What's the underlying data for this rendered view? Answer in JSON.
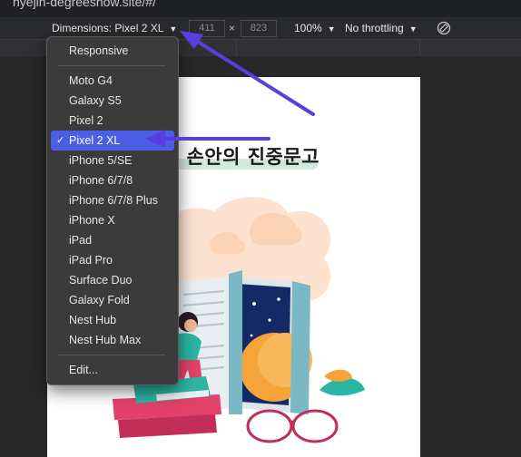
{
  "browser": {
    "url_fragment": "hyejin-degreeshow.site/#/"
  },
  "toolbar": {
    "dimensions_label": "Dimensions: Pixel 2 XL",
    "width_value": "411",
    "height_value": "823",
    "times": "×",
    "zoom": "100%",
    "throttling": "No throttling",
    "rotate_icon": "rotate-icon"
  },
  "menu": {
    "responsive": "Responsive",
    "devices": [
      "Moto G4",
      "Galaxy S5",
      "Pixel 2",
      "Pixel 2 XL",
      "iPhone 5/SE",
      "iPhone 6/7/8",
      "iPhone 6/7/8 Plus",
      "iPhone X",
      "iPad",
      "iPad Pro",
      "Surface Duo",
      "Galaxy Fold",
      "Nest Hub",
      "Nest Hub Max"
    ],
    "selected": "Pixel 2 XL",
    "edit": "Edit..."
  },
  "page": {
    "heading": "손안의 진중문고"
  },
  "annotation": {
    "arrow_color": "#5b3ddf"
  }
}
